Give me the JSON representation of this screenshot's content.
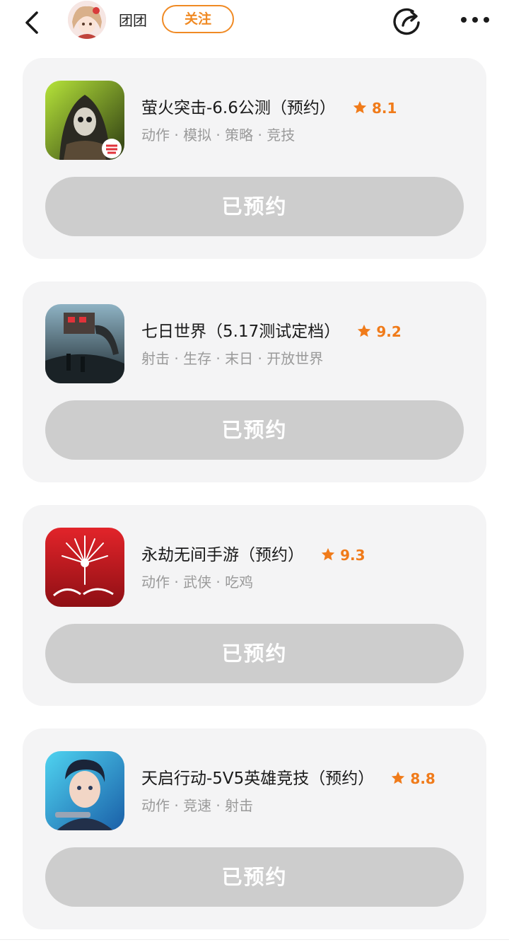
{
  "header": {
    "username": "团团",
    "follow_label": "关注"
  },
  "games": [
    {
      "title": "萤火突击-6.6公测（预约）",
      "rating": "8.1",
      "tags": "动作 · 模拟 · 策略 · 竞技",
      "button_label": "已预约"
    },
    {
      "title": "七日世界（5.17测试定档）",
      "rating": "9.2",
      "tags": "射击 · 生存 · 末日 · 开放世界",
      "button_label": "已预约"
    },
    {
      "title": "永劫无间手游（预约）",
      "rating": "9.3",
      "tags": "动作 · 武侠 · 吃鸡",
      "button_label": "已预约"
    },
    {
      "title": "天启行动-5V5英雄竞技（预约）",
      "rating": "8.8",
      "tags": "动作 · 竞速 · 射击",
      "button_label": "已预约"
    }
  ],
  "colors": {
    "accent": "#f08a24",
    "rating": "#f07b1a",
    "card_bg": "#f4f4f5",
    "button_bg": "#cdcdcd",
    "tag_text": "#9a9a9a"
  },
  "icons": [
    "back-icon",
    "avatar",
    "share-icon",
    "more-icon",
    "star-icon"
  ]
}
